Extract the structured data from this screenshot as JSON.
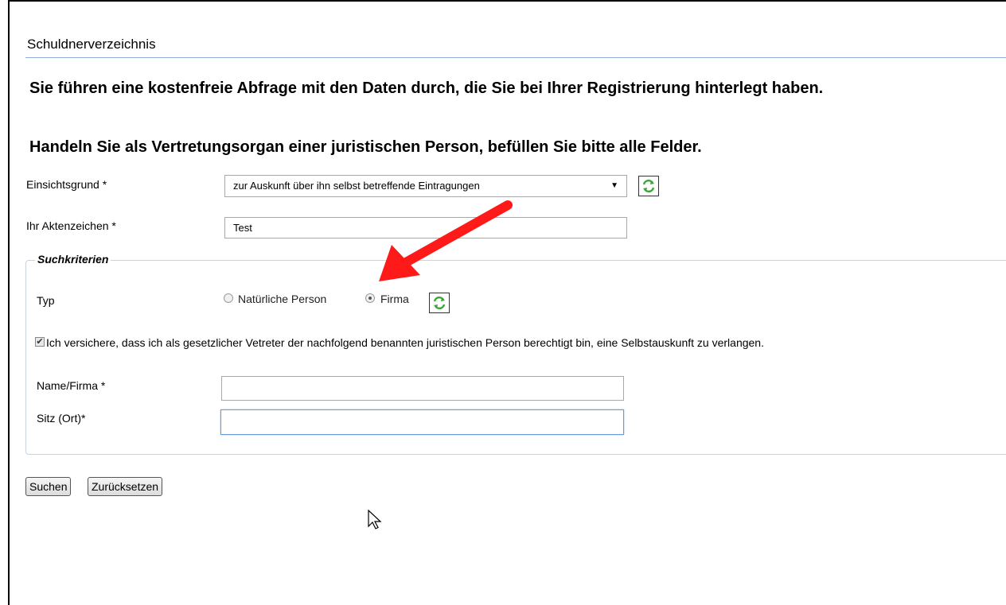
{
  "page": {
    "title": "Schuldnerverzeichnis",
    "heading1": "Sie führen eine kostenfreie Abfrage mit den Daten durch, die Sie bei Ihrer Registrierung hinterlegt haben.",
    "heading2": "Handeln Sie als Vertretungsorgan einer juristischen Person, befüllen Sie bitte alle Felder."
  },
  "form": {
    "einsichtsgrund_label": "Einsichtsgrund *",
    "einsichtsgrund_value": "zur Auskunft über ihn selbst betreffende Eintragungen",
    "aktenzeichen_label": "Ihr Aktenzeichen *",
    "aktenzeichen_value": "Test"
  },
  "suchkriterien": {
    "legend": "Suchkriterien",
    "typ_label": "Typ",
    "option_natural": "Natürliche Person",
    "option_firma": "Firma",
    "selected": "Firma",
    "confirm_checked": true,
    "confirm_text": "Ich versichere, dass ich als gesetzlicher Vetreter der nachfolgend benannten juristischen Person berechtigt bin, eine Selbstauskunft zu verlangen.",
    "name_label": "Name/Firma *",
    "name_value": "",
    "sitz_label": "Sitz (Ort)*",
    "sitz_value": ""
  },
  "buttons": {
    "search": "Suchen",
    "reset": "Zurücksetzen"
  },
  "colors": {
    "annotation_arrow": "#ff1a1a",
    "refresh_icon": "#3aa635",
    "title_rule": "#8fa9d8"
  }
}
